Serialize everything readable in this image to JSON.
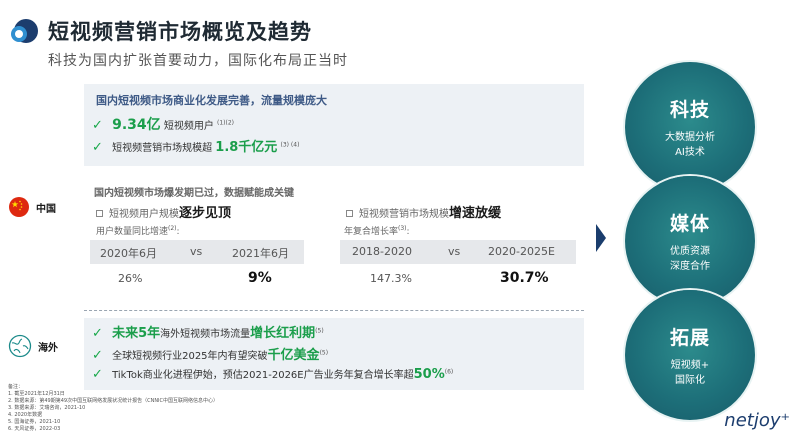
{
  "header": {
    "title": "短视频营销市场概览及趋势",
    "subtitle": "科技为国内扩张首要动力，国际化布局正当时"
  },
  "top_panel": {
    "heading": "国内短视频市场商业化发展完善，流量规模庞大",
    "row1": {
      "value": "9.34亿",
      "text": "短视频用户",
      "ref": "(1)(2)"
    },
    "row2": {
      "text": "短视频营销市场规模超",
      "value": "1.8千亿元",
      "ref": "(3) (4)"
    }
  },
  "china": {
    "region_label": "中国",
    "section_heading": "国内短视频市场爆发期已过，数据赋能成关键",
    "left": {
      "title_prefix": "短视频用户规模",
      "title_emph": "逐步见顶",
      "note": "用户数量同比增速",
      "note_ref": "(2)",
      "col1": "2020年6月",
      "vs": "vs",
      "col2": "2021年6月",
      "val1": "26%",
      "val2": "9%"
    },
    "right": {
      "title_prefix": "短视频营销市场规模",
      "title_emph": "增速放缓",
      "note": "年复合增长率",
      "note_ref": "(3)",
      "col1": "2018-2020",
      "vs": "vs",
      "col2": "2020-2025E",
      "val1": "147.3%",
      "val2": "30.7%"
    }
  },
  "overseas": {
    "region_label": "海外",
    "row1": {
      "emph1": "未来5年",
      "mid": "海外短视频市场流量",
      "emph2": "增长红利期",
      "ref": "(5)"
    },
    "row2": {
      "text": "全球短视频行业2025年内有望突破",
      "emph": "千亿美金",
      "ref": "(5)"
    },
    "row3": {
      "text": "TikTok商业化进程伊始，预估2021-2026E广告业务年复合增长率超",
      "emph": "50%",
      "ref": "(6)"
    }
  },
  "circles": [
    {
      "title": "科技",
      "line1": "大数据分析",
      "line2": "AI技术"
    },
    {
      "title": "媒体",
      "line1": "优质资源",
      "line2": "深度合作"
    },
    {
      "title": "拓展",
      "line1": "短视频+",
      "line2": "国际化"
    }
  ],
  "notes": [
    "备注：",
    "1.    截至2021年12月31日",
    "2.    数据来源：第49期第49次中国互联网络发展状况统计报告（CNNIC中国互联网络信息中心）",
    "3.    数据来源：艾瑞咨询，2021-10",
    "4.    2020年数据",
    "5.    国海证券，2021-10",
    "6.    天风证券，2022-03"
  ],
  "brand": "netjoy⁺",
  "colors": {
    "accent_green": "#1b9e4b",
    "circle_teal": "#1d6f79",
    "panel_bg": "#edf1f5",
    "heading_blue": "#3e5a86"
  }
}
